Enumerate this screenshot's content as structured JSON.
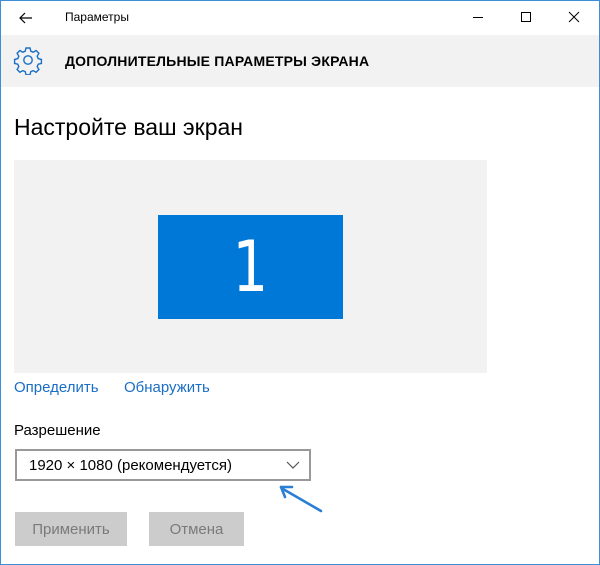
{
  "window": {
    "title": "Параметры",
    "icons": {
      "back": "back-arrow-icon",
      "minimize": "minimize-icon",
      "maximize": "maximize-icon",
      "close": "close-icon"
    }
  },
  "header": {
    "icon": "gear-icon",
    "title": "ДОПОЛНИТЕЛЬНЫЕ ПАРАМЕТРЫ ЭКРАНА"
  },
  "main": {
    "page_title": "Настройте ваш экран",
    "display_preview": {
      "monitor_number": "1",
      "monitor_color": "#0078d7",
      "background_color": "#f2f2f2"
    },
    "links": {
      "identify": "Определить",
      "detect": "Обнаружить"
    },
    "resolution": {
      "label": "Разрешение",
      "selected": "1920 × 1080 (рекомендуется)",
      "chevron_icon": "chevron-down-icon"
    },
    "annotation_icon": "pointer-arrow-icon",
    "buttons": {
      "apply": "Применить",
      "cancel": "Отмена"
    }
  },
  "colors": {
    "accent": "#0078d7",
    "link": "#1a6fc4",
    "disabled_button_bg": "#cccccc",
    "disabled_button_text": "#7a7a7a",
    "annotation_arrow": "#2a7fd4"
  }
}
